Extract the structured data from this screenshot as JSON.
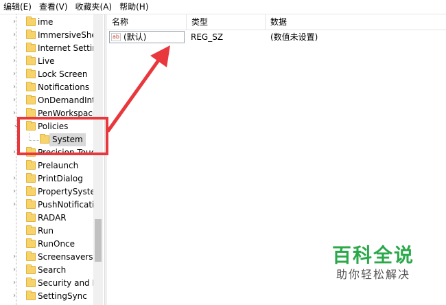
{
  "menu": [
    "编辑(E)",
    "查看(V)",
    "收藏夹(A)",
    "帮助(H)"
  ],
  "tree_items": [
    {
      "label": "ime",
      "expandable": true
    },
    {
      "label": "ImmersiveShel",
      "expandable": true
    },
    {
      "label": "Internet Setting",
      "expandable": true
    },
    {
      "label": "Live",
      "expandable": true
    },
    {
      "label": "Lock Screen",
      "expandable": true
    },
    {
      "label": "Notifications",
      "expandable": true
    },
    {
      "label": "OnDemandInt",
      "expandable": true
    },
    {
      "label": "PenWorkspace",
      "expandable": true
    },
    {
      "label": "Policies",
      "expandable": true,
      "expanded": true
    },
    {
      "label": "System",
      "expandable": false,
      "child": true,
      "selected": true
    },
    {
      "label": "Precision Touch",
      "expandable": true
    },
    {
      "label": "Prelaunch",
      "expandable": false
    },
    {
      "label": "PrintDialog",
      "expandable": true
    },
    {
      "label": "PropertySyster",
      "expandable": true
    },
    {
      "label": "PushNotificatio",
      "expandable": true
    },
    {
      "label": "RADAR",
      "expandable": false
    },
    {
      "label": "Run",
      "expandable": false
    },
    {
      "label": "RunOnce",
      "expandable": false
    },
    {
      "label": "Screensavers",
      "expandable": true
    },
    {
      "label": "Search",
      "expandable": true
    },
    {
      "label": "Security and M",
      "expandable": true
    },
    {
      "label": "SettingSync",
      "expandable": true
    }
  ],
  "columns": {
    "name": "名称",
    "type": "类型",
    "data": "数据"
  },
  "values": [
    {
      "icon": "string-value-icon",
      "icon_text": "ab",
      "name": "(默认)",
      "type": "REG_SZ",
      "data": "(数值未设置)"
    }
  ],
  "watermark": {
    "main": "百科全说",
    "sub": "助你轻松解决"
  },
  "colors": {
    "highlight_box": "#e8383d",
    "arrow": "#e8383d",
    "folder": "#f7d36b",
    "watermark": "#2aa84a"
  }
}
